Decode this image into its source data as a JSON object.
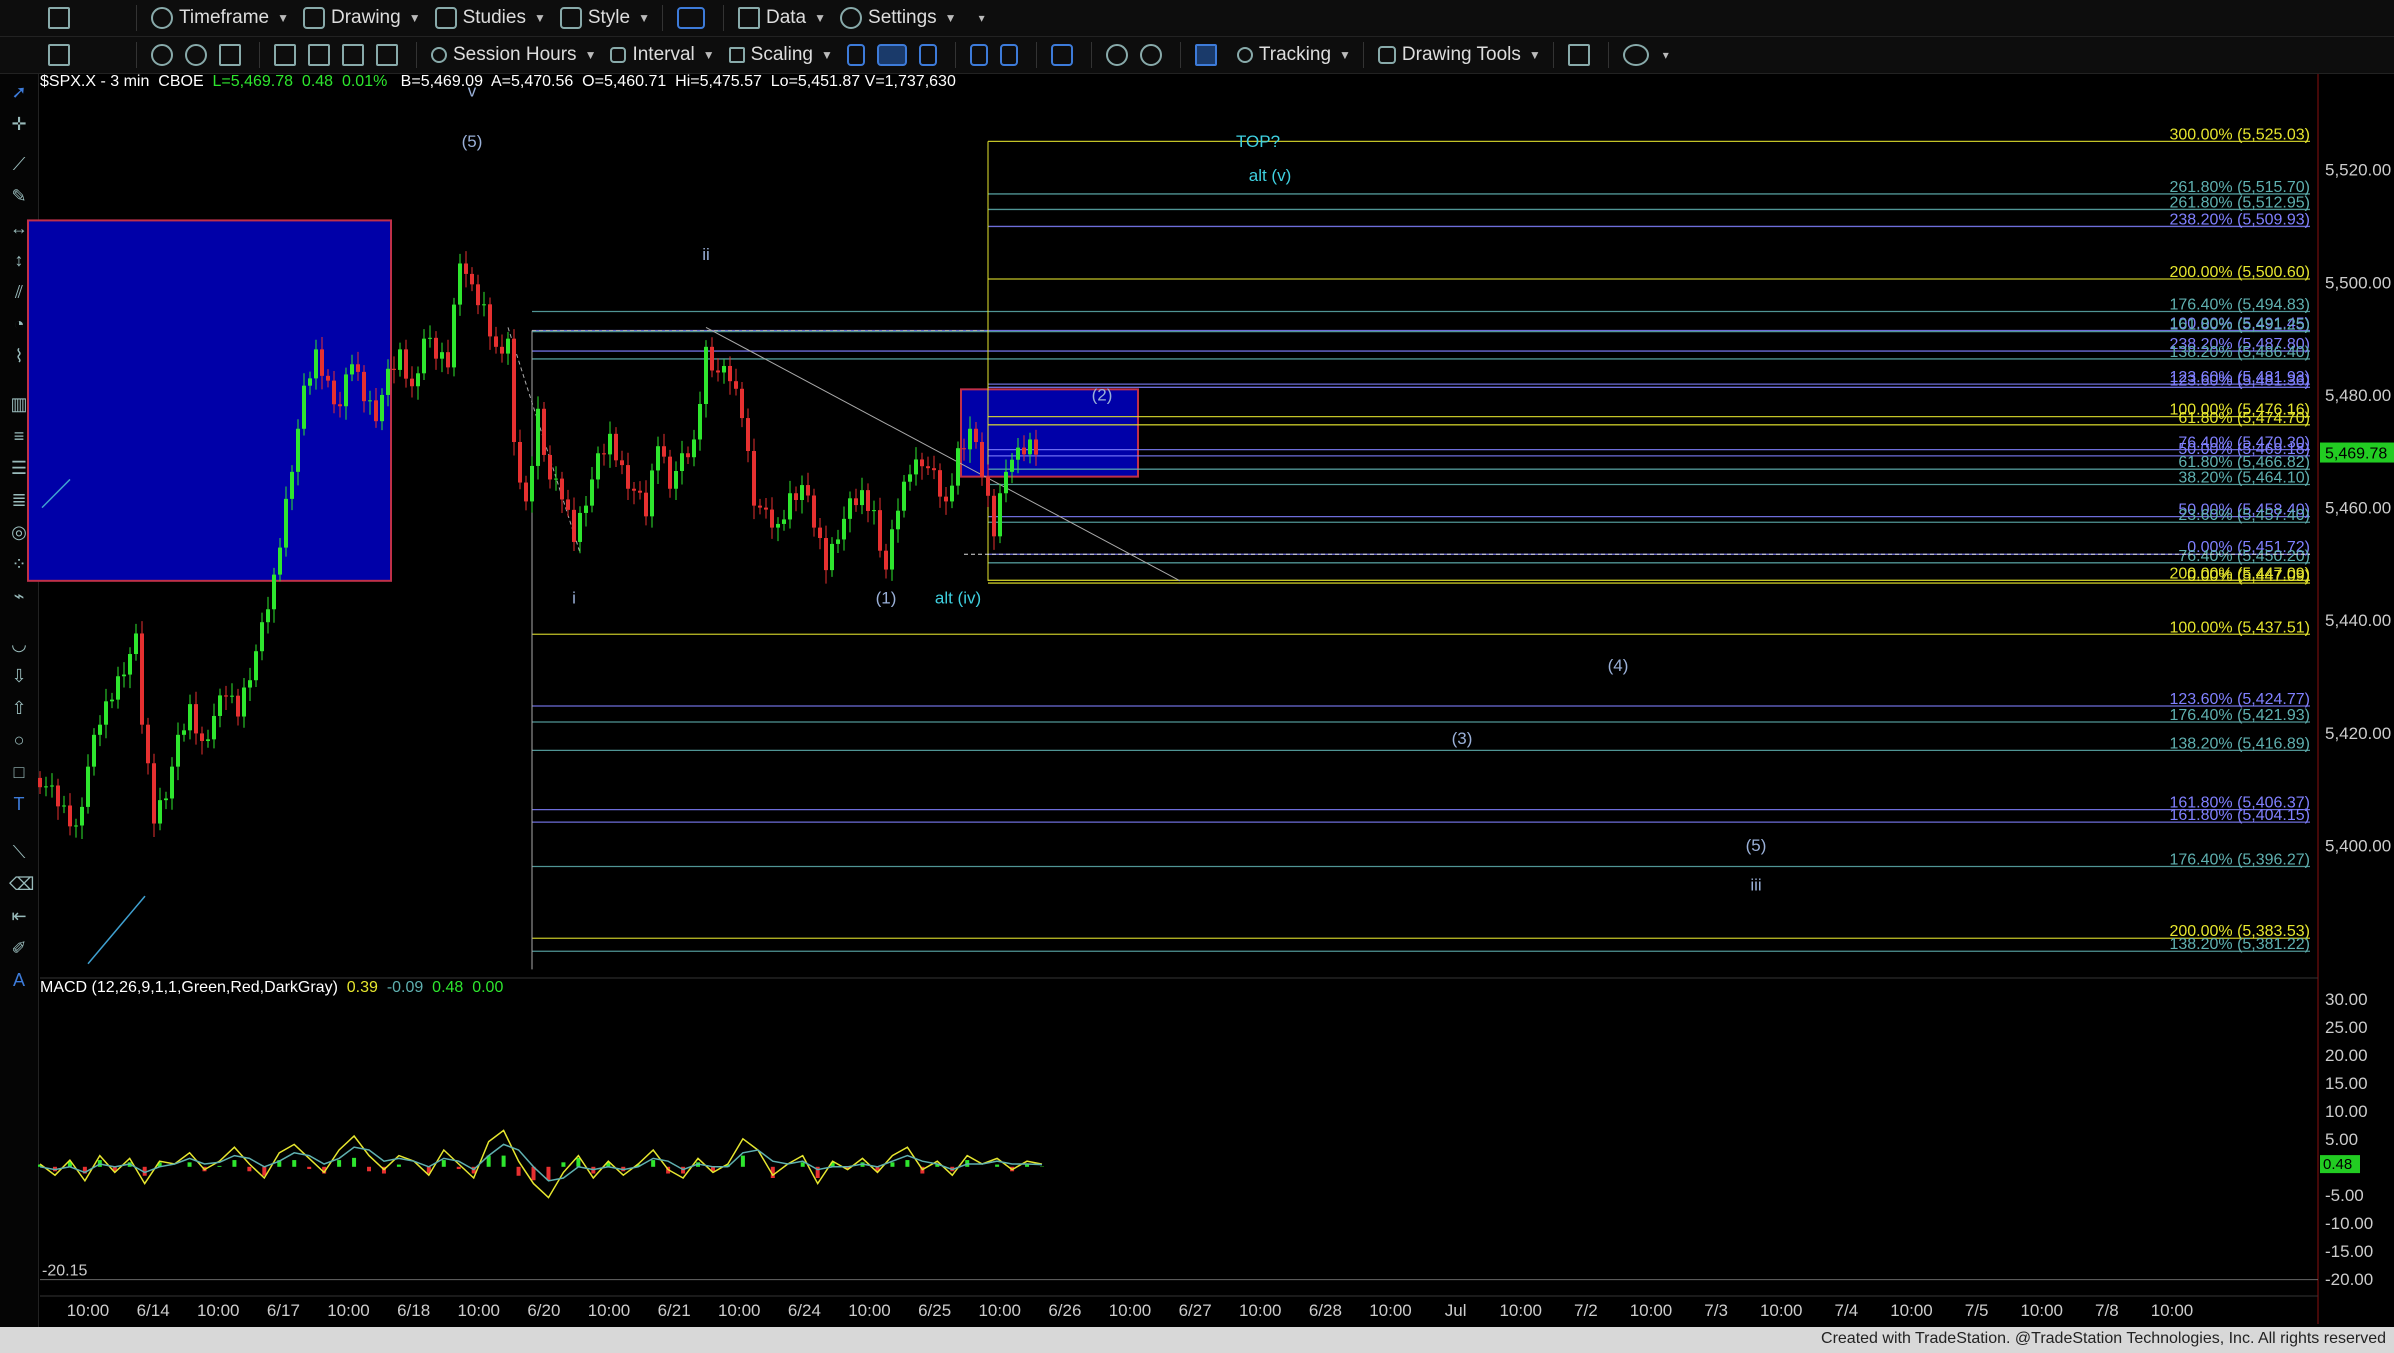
{
  "toolbar1": {
    "timeframe": "Timeframe",
    "drawing": "Drawing",
    "studies": "Studies",
    "style": "Style",
    "data": "Data",
    "settings": "Settings"
  },
  "toolbar2": {
    "session_hours": "Session Hours",
    "interval": "Interval",
    "scaling": "Scaling",
    "tracking": "Tracking",
    "drawing_tools": "Drawing Tools"
  },
  "symbol_info": {
    "symbol": "$SPX.X - 3 min",
    "exchange": "CBOE",
    "last": "L=5,469.78",
    "change": "0.48",
    "change_pct": "0.01%",
    "bid": "B=5,469.09",
    "ask": "A=5,470.56",
    "open": "O=5,460.71",
    "high": "Hi=5,475.57",
    "low": "Lo=5,451.87",
    "volume": "=1,737,630"
  },
  "macd_info": {
    "label": "MACD (12,26,9,1,1,Green,Red,DarkGray)",
    "v1": "0.39",
    "v2": "-0.09",
    "v3": "0.48",
    "v4": "0.00"
  },
  "status_text": "Created with TradeStation. @TradeStation Technologies, Inc. All rights reserved",
  "colors": {
    "background": "#000000",
    "bull": "#2ee62e",
    "bear": "#e63030",
    "fib_yellow": "#e6e62e",
    "fib_blue": "#8080ff",
    "fib_teal": "#5fb0b0",
    "box_blue": "#0000a8",
    "last_price_badge": "#22cc22"
  },
  "chart_data": [
    {
      "type": "line",
      "title": "$SPX.X - 3 min",
      "price_axis": {
        "ylim": [
          5377,
          5537
        ],
        "ticks": [
          "5,520.00",
          "5,500.00",
          "5,480.00",
          "5,460.00",
          "5,440.00",
          "5,420.00",
          "5,400.00"
        ],
        "tick_values": [
          5520,
          5500,
          5480,
          5460,
          5440,
          5420,
          5400
        ],
        "last_price": "5,469.78",
        "last_value": 5469.78
      },
      "time_axis": {
        "labels": [
          "10:00",
          "6/14",
          "10:00",
          "6/17",
          "10:00",
          "6/18",
          "10:00",
          "6/20",
          "10:00",
          "6/21",
          "10:00",
          "6/24",
          "10:00",
          "6/25",
          "10:00",
          "6/26",
          "10:00",
          "6/27",
          "10:00",
          "6/28",
          "10:00",
          "Jul",
          "10:00",
          "7/2",
          "10:00",
          "7/3",
          "10:00",
          "7/4",
          "10:00",
          "7/5",
          "10:00",
          "7/8",
          "10:00"
        ]
      },
      "series": [
        {
          "name": "price",
          "points": [
            [
              0,
              5412
            ],
            [
              4,
              5406
            ],
            [
              6,
              5403
            ],
            [
              8,
              5414
            ],
            [
              10,
              5422
            ],
            [
              12,
              5427
            ],
            [
              14,
              5432
            ],
            [
              16,
              5436
            ],
            [
              17,
              5422
            ],
            [
              19,
              5405
            ],
            [
              21,
              5410
            ],
            [
              23,
              5418
            ],
            [
              25,
              5424
            ],
            [
              27,
              5418
            ],
            [
              29,
              5423
            ],
            [
              31,
              5427
            ],
            [
              33,
              5424
            ],
            [
              35,
              5431
            ],
            [
              37,
              5438
            ],
            [
              39,
              5447
            ],
            [
              42,
              5468
            ],
            [
              44,
              5480
            ],
            [
              46,
              5487
            ],
            [
              48,
              5482
            ],
            [
              50,
              5478
            ],
            [
              52,
              5486
            ],
            [
              54,
              5480
            ],
            [
              56,
              5477
            ],
            [
              58,
              5483
            ],
            [
              60,
              5487
            ],
            [
              62,
              5481
            ],
            [
              64,
              5490
            ],
            [
              66,
              5487
            ],
            [
              68,
              5486
            ],
            [
              70,
              5505
            ],
            [
              72,
              5498
            ],
            [
              74,
              5495
            ],
            [
              76,
              5488
            ],
            [
              78,
              5490
            ],
            [
              79,
              5470
            ],
            [
              81,
              5460
            ],
            [
              83,
              5477
            ],
            [
              85,
              5465
            ],
            [
              87,
              5462
            ],
            [
              89,
              5455
            ],
            [
              91,
              5462
            ],
            [
              93,
              5468
            ],
            [
              95,
              5472
            ],
            [
              97,
              5467
            ],
            [
              99,
              5463
            ],
            [
              101,
              5459
            ],
            [
              103,
              5472
            ],
            [
              105,
              5465
            ],
            [
              107,
              5468
            ],
            [
              109,
              5471
            ],
            [
              111,
              5488
            ],
            [
              113,
              5484
            ],
            [
              115,
              5483
            ],
            [
              117,
              5477
            ],
            [
              119,
              5462
            ],
            [
              121,
              5458
            ],
            [
              123,
              5456
            ],
            [
              125,
              5462
            ],
            [
              127,
              5464
            ],
            [
              129,
              5457
            ],
            [
              131,
              5450
            ],
            [
              133,
              5456
            ],
            [
              135,
              5460
            ],
            [
              137,
              5462
            ],
            [
              139,
              5459
            ],
            [
              141,
              5449
            ],
            [
              143,
              5460
            ],
            [
              145,
              5467
            ],
            [
              147,
              5469
            ],
            [
              149,
              5465
            ],
            [
              151,
              5460
            ],
            [
              153,
              5470
            ],
            [
              155,
              5474
            ],
            [
              157,
              5466
            ],
            [
              159,
              5456
            ],
            [
              161,
              5468
            ],
            [
              163,
              5469
            ],
            [
              165,
              5471
            ],
            [
              167,
              5470
            ]
          ]
        }
      ],
      "fib_levels": [
        {
          "label": "300.00% (5,525.03)",
          "value": 5525.03,
          "color": "yellow"
        },
        {
          "label": "261.80% (5,515.70)",
          "value": 5515.7,
          "color": "teal"
        },
        {
          "label": "261.80% (5,512.95)",
          "value": 5512.95,
          "color": "teal"
        },
        {
          "label": "238.20% (5,509.93)",
          "value": 5509.93,
          "color": "blue"
        },
        {
          "label": "200.00% (5,500.60)",
          "value": 5500.6,
          "color": "yellow"
        },
        {
          "label": "176.40% (5,494.83)",
          "value": 5494.83,
          "color": "teal"
        },
        {
          "label": "100.00% (5,491.45)",
          "value": 5491.45,
          "color": "blue"
        },
        {
          "label": "161.80% (5,491.25)",
          "value": 5491.25,
          "color": "teal"
        },
        {
          "label": "238.20% (5,487.80)",
          "value": 5487.8,
          "color": "blue"
        },
        {
          "label": "138.20% (5,486.40)",
          "value": 5486.4,
          "color": "teal"
        },
        {
          "label": "123.60% (5,481.93)",
          "value": 5481.93,
          "color": "blue"
        },
        {
          "label": "123.60% (5,481.36)",
          "value": 5481.36,
          "color": "blue"
        },
        {
          "label": "100.00% (5,476.16)",
          "value": 5476.16,
          "color": "yellow"
        },
        {
          "label": "61.80% (5,474.70)",
          "value": 5474.7,
          "color": "yellow"
        },
        {
          "label": "76.40% (5,470.30)",
          "value": 5470.3,
          "color": "blue"
        },
        {
          "label": "50.00% (5,469.18)",
          "value": 5469.18,
          "color": "blue"
        },
        {
          "label": "61.80% (5,466.82)",
          "value": 5466.82,
          "color": "teal"
        },
        {
          "label": "38.20% (5,464.10)",
          "value": 5464.1,
          "color": "teal"
        },
        {
          "label": "50.00% (5,458.40)",
          "value": 5458.4,
          "color": "blue"
        },
        {
          "label": "23.60% (5,457.40)",
          "value": 5457.4,
          "color": "teal"
        },
        {
          "label": "0.00% (5,451.72)",
          "value": 5451.72,
          "color": "blue"
        },
        {
          "label": "76.40% (5,450.20)",
          "value": 5450.2,
          "color": "teal"
        },
        {
          "label": "200.00% (5,447.09)",
          "value": 5447.09,
          "color": "yellow"
        },
        {
          "label": "0.00% (5,447.09)",
          "value": 5446.6,
          "color": "yellow"
        },
        {
          "label": "100.00% (5,437.51)",
          "value": 5437.51,
          "color": "yellow"
        },
        {
          "label": "123.60% (5,424.77)",
          "value": 5424.77,
          "color": "blue"
        },
        {
          "label": "176.40% (5,421.93)",
          "value": 5421.93,
          "color": "teal"
        },
        {
          "label": "138.20% (5,416.89)",
          "value": 5416.89,
          "color": "teal"
        },
        {
          "label": "161.80% (5,406.37)",
          "value": 5406.37,
          "color": "blue"
        },
        {
          "label": "161.80% (5,404.15)",
          "value": 5404.15,
          "color": "blue"
        },
        {
          "label": "176.40% (5,396.27)",
          "value": 5396.27,
          "color": "teal"
        },
        {
          "label": "200.00% (5,383.53)",
          "value": 5383.53,
          "color": "yellow"
        },
        {
          "label": "138.20% (5,381.22)",
          "value": 5381.22,
          "color": "teal"
        }
      ],
      "wave_labels": [
        {
          "text": "v",
          "x": 72,
          "value": 5533
        },
        {
          "text": "(5)",
          "x": 72,
          "value": 5524
        },
        {
          "text": "ii",
          "x": 111,
          "value": 5504
        },
        {
          "text": "i",
          "x": 89,
          "value": 5443
        },
        {
          "text": "(1)",
          "x": 141,
          "value": 5443
        },
        {
          "text": "alt (iv)",
          "x": 153,
          "value": 5443
        },
        {
          "text": "(2)",
          "x": 177,
          "value": 5479
        },
        {
          "text": "TOP?",
          "x": 203,
          "value": 5524
        },
        {
          "text": "alt (v)",
          "x": 205,
          "value": 5518
        },
        {
          "text": "(4)",
          "x": 263,
          "value": 5431
        },
        {
          "text": "(3)",
          "x": 237,
          "value": 5418
        },
        {
          "text": "(5)",
          "x": 286,
          "value": 5399
        },
        {
          "text": "iii",
          "x": 286,
          "value": 5392
        }
      ]
    },
    {
      "type": "line",
      "title": "MACD (12,26,9,1,1,Green,Red,DarkGray)",
      "ylim": [
        -22,
        33
      ],
      "ticks": [
        "30.00",
        "25.00",
        "20.00",
        "15.00",
        "10.00",
        "5.00",
        "0.00",
        "-5.00",
        "-10.00",
        "-15.00",
        "-20.00"
      ],
      "tick_values": [
        30,
        25,
        20,
        15,
        10,
        5,
        0,
        -5,
        -10,
        -15,
        -20
      ],
      "low_label": "-20.15",
      "last_label": "0.48",
      "last_value": 0.48,
      "series": [
        {
          "name": "MACD",
          "values": [
            0.5,
            -1.5,
            1.2,
            -2.5,
            2.0,
            -1.0,
            1.5,
            -3.0,
            1.0,
            0.5,
            2.5,
            -0.5,
            1.0,
            3.5,
            0.5,
            -2.0,
            2.5,
            4.0,
            1.5,
            -1.0,
            3.0,
            5.5,
            2.0,
            -0.5,
            2.0,
            1.0,
            -1.5,
            3.0,
            0.5,
            -2.0,
            4.5,
            6.5,
            1.0,
            -3.0,
            -5.5,
            -1.0,
            2.0,
            -2.0,
            1.0,
            -1.5,
            0.5,
            3.0,
            -0.5,
            -2.0,
            1.5,
            -1.0,
            0.5,
            5.0,
            3.0,
            -1.5,
            0.5,
            2.0,
            -3.0,
            1.0,
            -0.5,
            1.5,
            -1.0,
            2.0,
            3.5,
            -0.5,
            1.0,
            -1.5,
            2.0,
            0.5,
            1.5,
            -0.5,
            1.0,
            0.48
          ]
        },
        {
          "name": "Signal",
          "values": [
            0.0,
            -0.5,
            0.0,
            -1.0,
            0.5,
            0.0,
            0.5,
            -1.0,
            0.0,
            0.5,
            1.5,
            0.5,
            0.8,
            2.0,
            1.5,
            0.0,
            1.0,
            2.5,
            2.0,
            0.5,
            1.5,
            3.5,
            3.0,
            1.0,
            1.5,
            1.0,
            0.0,
            1.5,
            1.0,
            -0.5,
            2.0,
            4.0,
            3.0,
            0.0,
            -2.5,
            -2.0,
            0.0,
            -0.5,
            0.0,
            -0.5,
            0.0,
            1.5,
            1.0,
            -0.5,
            0.5,
            0.0,
            0.0,
            2.5,
            3.0,
            1.0,
            0.5,
            1.0,
            -0.5,
            0.0,
            0.0,
            0.5,
            0.0,
            1.0,
            2.0,
            1.0,
            0.5,
            -0.5,
            0.5,
            0.5,
            1.0,
            0.5,
            0.5,
            0.39
          ]
        }
      ]
    }
  ]
}
